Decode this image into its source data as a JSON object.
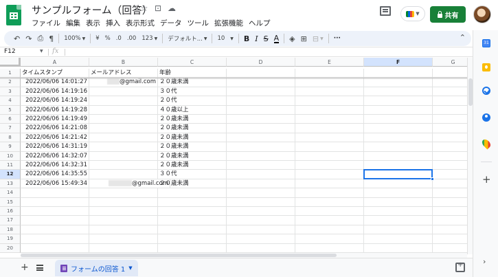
{
  "header": {
    "title": "サンプルフォーム（回答）",
    "menu": [
      "ファイル",
      "編集",
      "表示",
      "挿入",
      "表示形式",
      "データ",
      "ツール",
      "拡張機能",
      "ヘルプ"
    ],
    "share_label": "共有"
  },
  "toolbar": {
    "zoom": "100%",
    "currency": "¥",
    "percent": "%",
    "dec_decrease": ".0",
    "dec_increase": ".00",
    "more_formats": "123",
    "font": "デフォルト...",
    "font_size": "10",
    "bold": "B",
    "italic": "I",
    "strike": "S",
    "text_color": "A",
    "more": "···"
  },
  "formula_bar": {
    "name_box": "F12",
    "fx": "fx"
  },
  "columns": [
    "A",
    "B",
    "C",
    "D",
    "E",
    "F",
    "G"
  ],
  "selected_column": "F",
  "selected_row": 12,
  "rows": [
    {
      "num": "1",
      "a": "タイムスタンプ",
      "b": "メールアドレス",
      "c": "年齢"
    },
    {
      "num": "2",
      "a": "2022/06/06 14:01:27",
      "b": "@gmail.com",
      "c": "２０歳未満"
    },
    {
      "num": "3",
      "a": "2022/06/06 14:19:16",
      "b": "",
      "c": "３０代"
    },
    {
      "num": "4",
      "a": "2022/06/06 14:19:24",
      "b": "",
      "c": "２０代"
    },
    {
      "num": "5",
      "a": "2022/06/06 14:19:28",
      "b": "",
      "c": "４０歳以上"
    },
    {
      "num": "6",
      "a": "2022/06/06 14:19:49",
      "b": "",
      "c": "２０歳未満"
    },
    {
      "num": "7",
      "a": "2022/06/06 14:21:08",
      "b": "",
      "c": "２０歳未満"
    },
    {
      "num": "8",
      "a": "2022/06/06 14:21:42",
      "b": "",
      "c": "２０歳未満"
    },
    {
      "num": "9",
      "a": "2022/06/06 14:31:19",
      "b": "",
      "c": "２０歳未満"
    },
    {
      "num": "10",
      "a": "2022/06/06 14:32:07",
      "b": "",
      "c": "２０歳未満"
    },
    {
      "num": "11",
      "a": "2022/06/06 14:32:31",
      "b": "",
      "c": "２０歳未満"
    },
    {
      "num": "12",
      "a": "2022/06/06 14:35:55",
      "b": "",
      "c": "３０代"
    },
    {
      "num": "13",
      "a": "2022/06/06 15:49:34",
      "b": "@gmail.com",
      "c": "２０歳未満"
    },
    {
      "num": "14",
      "a": "",
      "b": "",
      "c": ""
    },
    {
      "num": "15",
      "a": "",
      "b": "",
      "c": ""
    },
    {
      "num": "16",
      "a": "",
      "b": "",
      "c": ""
    },
    {
      "num": "17",
      "a": "",
      "b": "",
      "c": ""
    },
    {
      "num": "18",
      "a": "",
      "b": "",
      "c": ""
    },
    {
      "num": "19",
      "a": "",
      "b": "",
      "c": ""
    },
    {
      "num": "20",
      "a": "",
      "b": "",
      "c": ""
    }
  ],
  "sheet_tab": {
    "label": "フォームの回答 1"
  },
  "colors": {
    "brand_green": "#0f9d58",
    "share_green": "#188038",
    "selection_blue": "#1a73e8"
  }
}
